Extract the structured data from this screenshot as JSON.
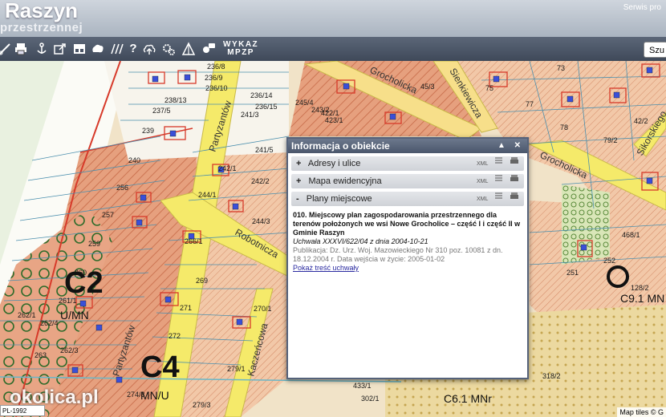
{
  "header": {
    "title": "Raszyn",
    "subtitle": "przestrzennej",
    "service_text": "Serwis pro"
  },
  "toolbar": {
    "wykaz_line1": "WYKAZ",
    "wykaz_line2": "MPZP",
    "search_label": "Szu",
    "icons": [
      "ruler-icon",
      "print-icon",
      "anchor-icon",
      "export-icon",
      "layout-icon",
      "cloud-shape-icon",
      "hatch-icon",
      "help-icon",
      "cloud-upload-icon",
      "gears-icon",
      "terrain-icon",
      "chat-icon"
    ]
  },
  "map": {
    "parcel_labels": [
      "236/8",
      "236/9",
      "236/10",
      "236/14",
      "236/15",
      "238/13",
      "237/5",
      "239",
      "240",
      "241/3",
      "241/5",
      "242/1",
      "242/2",
      "243/2",
      "245/4",
      "256",
      "257",
      "259",
      "260",
      "261/1",
      "262/1",
      "262/3",
      "262/4",
      "263",
      "269",
      "270/1",
      "271",
      "272",
      "279/1",
      "279/3",
      "274/3",
      "422/1",
      "423/1",
      "433/1",
      "302/1",
      "73",
      "75",
      "77",
      "78",
      "79/2",
      "42/2",
      "45/3",
      "468/1",
      "251",
      "252",
      "128/2",
      "318/2",
      "244/1",
      "244/3",
      "266/1"
    ],
    "zone_labels": [
      "C2",
      "U/MN",
      "C4",
      "MN/U",
      "C6.1 MNr",
      "C9.1 MN"
    ],
    "street_labels": [
      "Partyzantów",
      "Robotnicza",
      "Kaczeńcowa",
      "Grocholicka",
      "Sienkiewicza",
      "Sikorskiego",
      "Grocholicka"
    ],
    "watermark": "okolica.pl",
    "crs": "PL-1992",
    "attribution": "Map tiles © G"
  },
  "panel": {
    "title": "Informacja o obiekcie",
    "controls": "▲ ✕",
    "sections": [
      {
        "sign": "+",
        "label": "Adresy i ulice",
        "xml": "XML"
      },
      {
        "sign": "+",
        "label": "Mapa ewidencyjna",
        "xml": "XML"
      },
      {
        "sign": "-",
        "label": "Plany miejscowe",
        "xml": "XML"
      }
    ],
    "plan_title": "010. Miejscowy plan zagospodarowania przestrzennego dla terenów położonych we wsi Nowe Grocholice – część I i część II w Gminie Raszyn",
    "resolution": "Uchwała XXXVI/622/04 z dnia 2004-10-21",
    "publication": "Publikacja: Dz. Urz. Woj. Mazowieckiego Nr 310 poz. 10081 z dn. 18.12.2004 r. Data wejścia w życie: 2005-01-02",
    "show_link": "Pokaż treść uchwały"
  }
}
